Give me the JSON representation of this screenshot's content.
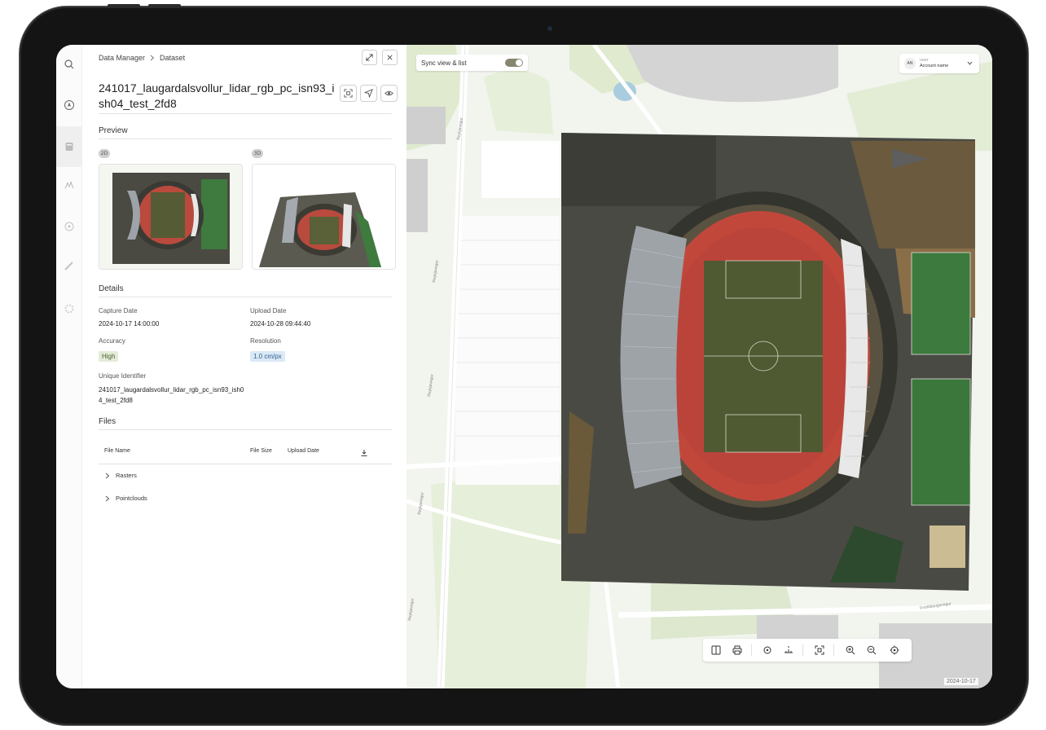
{
  "breadcrumb": {
    "root": "Data Manager",
    "current": "Dataset"
  },
  "dataset": {
    "title": "241017_laugardalsvollur_lidar_rgb_pc_isn93_ish04_test_2fd8"
  },
  "preview": {
    "heading": "Preview",
    "badges": [
      "2D",
      "3D"
    ]
  },
  "details": {
    "heading": "Details",
    "capture_date_label": "Capture Date",
    "capture_date": "2024-10-17 14:00:00",
    "upload_date_label": "Upload Date",
    "upload_date": "2024-10-28 09:44:40",
    "accuracy_label": "Accuracy",
    "accuracy": "High",
    "resolution_label": "Resolution",
    "resolution": "1.0 cm/px",
    "uid_label": "Unique Identifier",
    "uid": "241017_laugardalsvollur_lidar_rgb_pc_isn93_ish04_test_2fd8"
  },
  "files": {
    "heading": "Files",
    "columns": [
      "File Name",
      "File Size",
      "Upload Date"
    ],
    "rows": [
      "Rasters",
      "Pointclouds"
    ]
  },
  "map": {
    "sync_label": "Sync view & list",
    "sync_on": true,
    "account_initials": "AN",
    "account_user": "user",
    "account_name": "Account name",
    "date_tag": "2024-10-17",
    "road_labels": [
      "Reykjavegur",
      "Reykjavegur",
      "Reykjavegur",
      "Reykjavegur",
      "Reykjavegur",
      "Þvottalaugavegur"
    ]
  },
  "colors": {
    "accuracy_bg": "#e4ecd9",
    "accuracy_fg": "#4a5e2e",
    "resolution_bg": "#dbe9f6",
    "resolution_fg": "#2e5f8a",
    "title": "#222222",
    "track": "#c2473b",
    "pitch": "#4f5a33",
    "toggle": "#878770"
  }
}
